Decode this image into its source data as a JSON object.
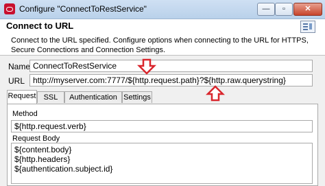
{
  "window": {
    "title": "Configure \"ConnectToRestService\"",
    "minimize_label": "—",
    "restore_label": "▫",
    "close_label": "✕"
  },
  "header": {
    "title": "Connect to URL",
    "description": "Connect to the URL specified.  Configure options when connecting to the URL for HTTPS, Secure Connections and Connection Settings."
  },
  "form": {
    "name_label": "Name:",
    "name_value": "ConnectToRestService",
    "url_label": "URL",
    "url_value": "http://myserver.com:7777/${http.request.path}?${http.raw.querystring}"
  },
  "tabs": [
    {
      "label": "Request",
      "active": true
    },
    {
      "label": "SSL",
      "active": false
    },
    {
      "label": "Authentication",
      "active": false
    },
    {
      "label": "Settings",
      "active": false
    }
  ],
  "request": {
    "method_label": "Method",
    "method_value": "${http.request.verb}",
    "body_label": "Request Body",
    "body_lines": [
      "${content.body}",
      "${http.headers}",
      "${authentication.subject.id}"
    ]
  },
  "colors": {
    "annotation_arrow": "#d9262d",
    "title_bar": "#c4d8ee"
  },
  "icons": {
    "app": "oracle-logo-icon",
    "help": "help-icon",
    "annotation": "red-arrow-icon"
  }
}
